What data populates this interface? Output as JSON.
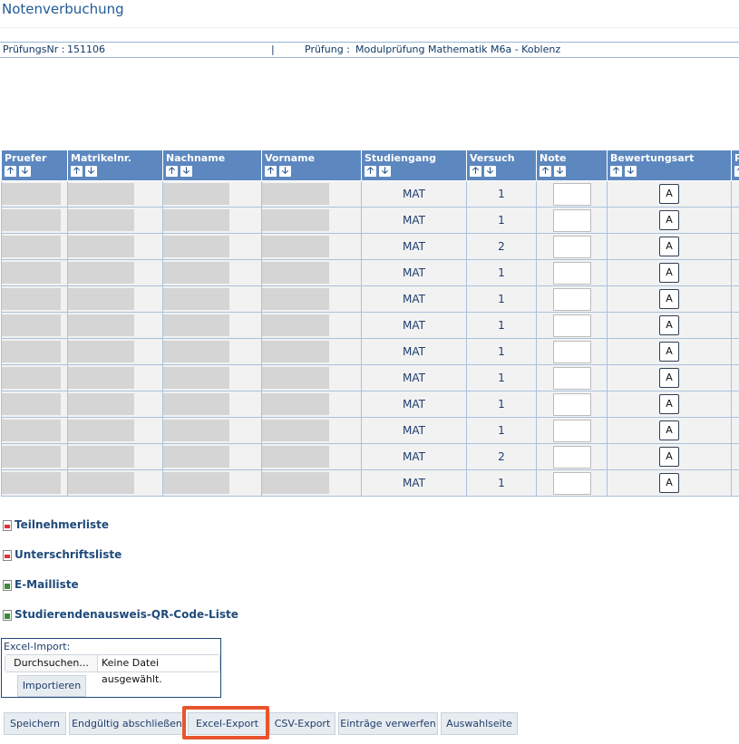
{
  "page": {
    "title": "Notenverbuchung",
    "info": {
      "pruefungsnr_label": "PrüfungsNr :",
      "pruefungsnr_value": "151106",
      "separator": "|",
      "pruefung_label": "Prüfung :",
      "pruefung_value": "Modulprüfung Mathematik M6a - Koblenz"
    }
  },
  "table": {
    "columns": [
      "Pruefer",
      "Matrikelnr.",
      "Nachname",
      "Vorname",
      "Studiengang",
      "Versuch",
      "Note",
      "Bewertungsart",
      "P"
    ],
    "sort_up": "🡡",
    "sort_down": "🡣",
    "rows": [
      {
        "studiengang": "MAT",
        "versuch": "1",
        "note": "",
        "bewertungsart": "A"
      },
      {
        "studiengang": "MAT",
        "versuch": "1",
        "note": "",
        "bewertungsart": "A"
      },
      {
        "studiengang": "MAT",
        "versuch": "2",
        "note": "",
        "bewertungsart": "A"
      },
      {
        "studiengang": "MAT",
        "versuch": "1",
        "note": "",
        "bewertungsart": "A"
      },
      {
        "studiengang": "MAT",
        "versuch": "1",
        "note": "",
        "bewertungsart": "A"
      },
      {
        "studiengang": "MAT",
        "versuch": "1",
        "note": "",
        "bewertungsart": "A"
      },
      {
        "studiengang": "MAT",
        "versuch": "1",
        "note": "",
        "bewertungsart": "A"
      },
      {
        "studiengang": "MAT",
        "versuch": "1",
        "note": "",
        "bewertungsart": "A"
      },
      {
        "studiengang": "MAT",
        "versuch": "1",
        "note": "",
        "bewertungsart": "A"
      },
      {
        "studiengang": "MAT",
        "versuch": "1",
        "note": "",
        "bewertungsart": "A"
      },
      {
        "studiengang": "MAT",
        "versuch": "2",
        "note": "",
        "bewertungsart": "A"
      },
      {
        "studiengang": "MAT",
        "versuch": "1",
        "note": "",
        "bewertungsart": "A"
      }
    ]
  },
  "links": [
    {
      "label": "Teilnehmerliste",
      "icon": "pdf-icon"
    },
    {
      "label": "Unterschriftsliste",
      "icon": "pdf-icon"
    },
    {
      "label": "E-Mailliste",
      "icon": "excel-icon"
    },
    {
      "label": "Studierendenausweis-QR-Code-Liste",
      "icon": "excel-icon"
    }
  ],
  "import": {
    "label": "Excel-Import:",
    "browse": "Durchsuchen...",
    "status": "Keine Datei ausgewählt.",
    "import_button": "Importieren"
  },
  "actions": {
    "save": "Speichern",
    "finalize": "Endgültig abschließen",
    "excel_export": "Excel-Export",
    "csv_export": "CSV-Export",
    "discard": "Einträge verwerfen",
    "selection_page": "Auswahlseite"
  },
  "colors": {
    "header_bg": "#5d87bf",
    "highlight": "#e8542e"
  }
}
